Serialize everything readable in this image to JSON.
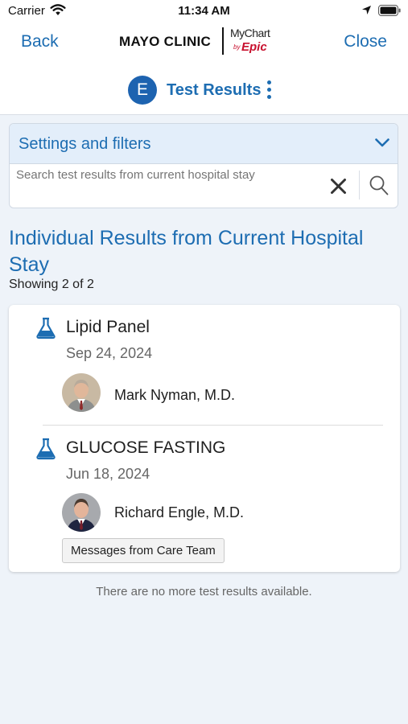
{
  "status_bar": {
    "carrier": "Carrier",
    "time": "11:34 AM"
  },
  "nav": {
    "back": "Back",
    "close": "Close"
  },
  "brand": {
    "name": "MAYO CLINIC",
    "mychart": "MyChart",
    "by": "by",
    "epic": "Epic"
  },
  "header": {
    "avatar_initial": "E",
    "title": "Test Results"
  },
  "filters": {
    "title": "Settings and filters",
    "search_placeholder": "Search test results from current hospital stay"
  },
  "section": {
    "title": "Individual Results from Current Hospital Stay",
    "showing": "Showing 2 of 2"
  },
  "results": [
    {
      "name": "Lipid Panel",
      "date": "Sep 24, 2024",
      "provider": "Mark Nyman, M.D."
    },
    {
      "name": "GLUCOSE FASTING",
      "date": "Jun 18, 2024",
      "provider": "Richard Engle, M.D.",
      "action": "Messages from Care Team"
    }
  ],
  "footer_note": "There are no more test results available.",
  "colors": {
    "accent": "#1d6db2",
    "avatar": "#1d63b0",
    "background": "#eef3f9",
    "filter_header": "#e3eefa",
    "epic_red": "#c8102e"
  },
  "icons": [
    "wifi-icon",
    "location-arrow-icon",
    "battery-icon",
    "more-options-icon",
    "chevron-down-icon",
    "clear-icon",
    "search-icon",
    "flask-icon"
  ]
}
